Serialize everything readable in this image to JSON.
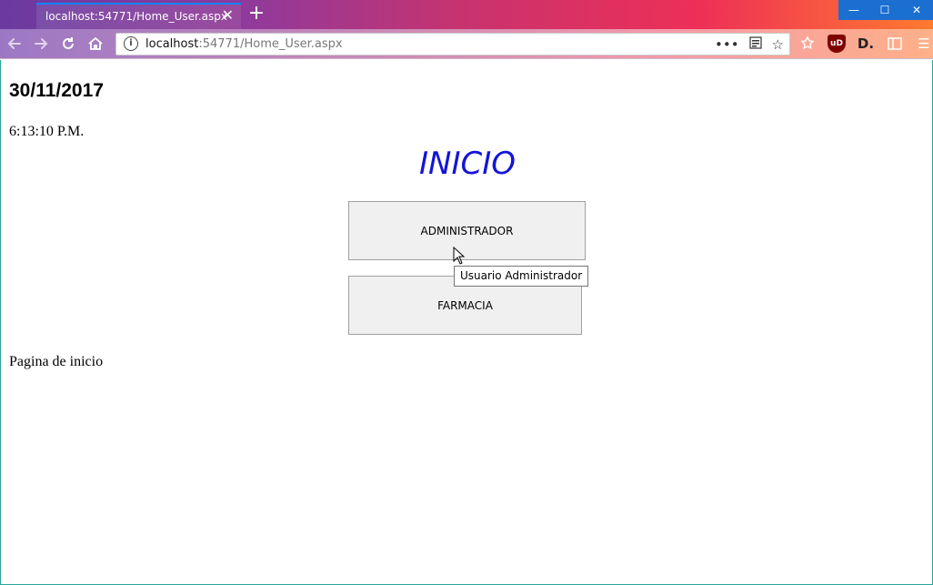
{
  "browser": {
    "tab_title": "localhost:54771/Home_User.aspx",
    "tab_close_glyph": "✕",
    "new_tab_glyph": "+",
    "url_host": "localhost",
    "url_rest": ":54771/Home_User.aspx",
    "window_controls": {
      "minimize": "—",
      "maximize": "☐",
      "close": "✕"
    },
    "icons": [
      "back-icon",
      "forward-icon",
      "reload-icon",
      "home-icon",
      "info-icon",
      "more-icon",
      "reader-icon",
      "bookmark-star-icon",
      "library-icon",
      "ublock-icon",
      "extension-icon",
      "sidebar-icon",
      "menu-icon"
    ],
    "ublock_label": "uD",
    "extension_label": "D."
  },
  "page": {
    "date": "30/11/2017",
    "time": "6:13:10 P.M.",
    "title": "INICIO",
    "buttons": {
      "admin_label": "ADMINISTRADOR",
      "farmacia_label": "FARMACIA"
    },
    "tooltip": "Usuario Administrador",
    "footer": "Pagina de inicio"
  },
  "colors": {
    "title_color": "#1414d8",
    "button_bg": "#f0f0f0"
  }
}
